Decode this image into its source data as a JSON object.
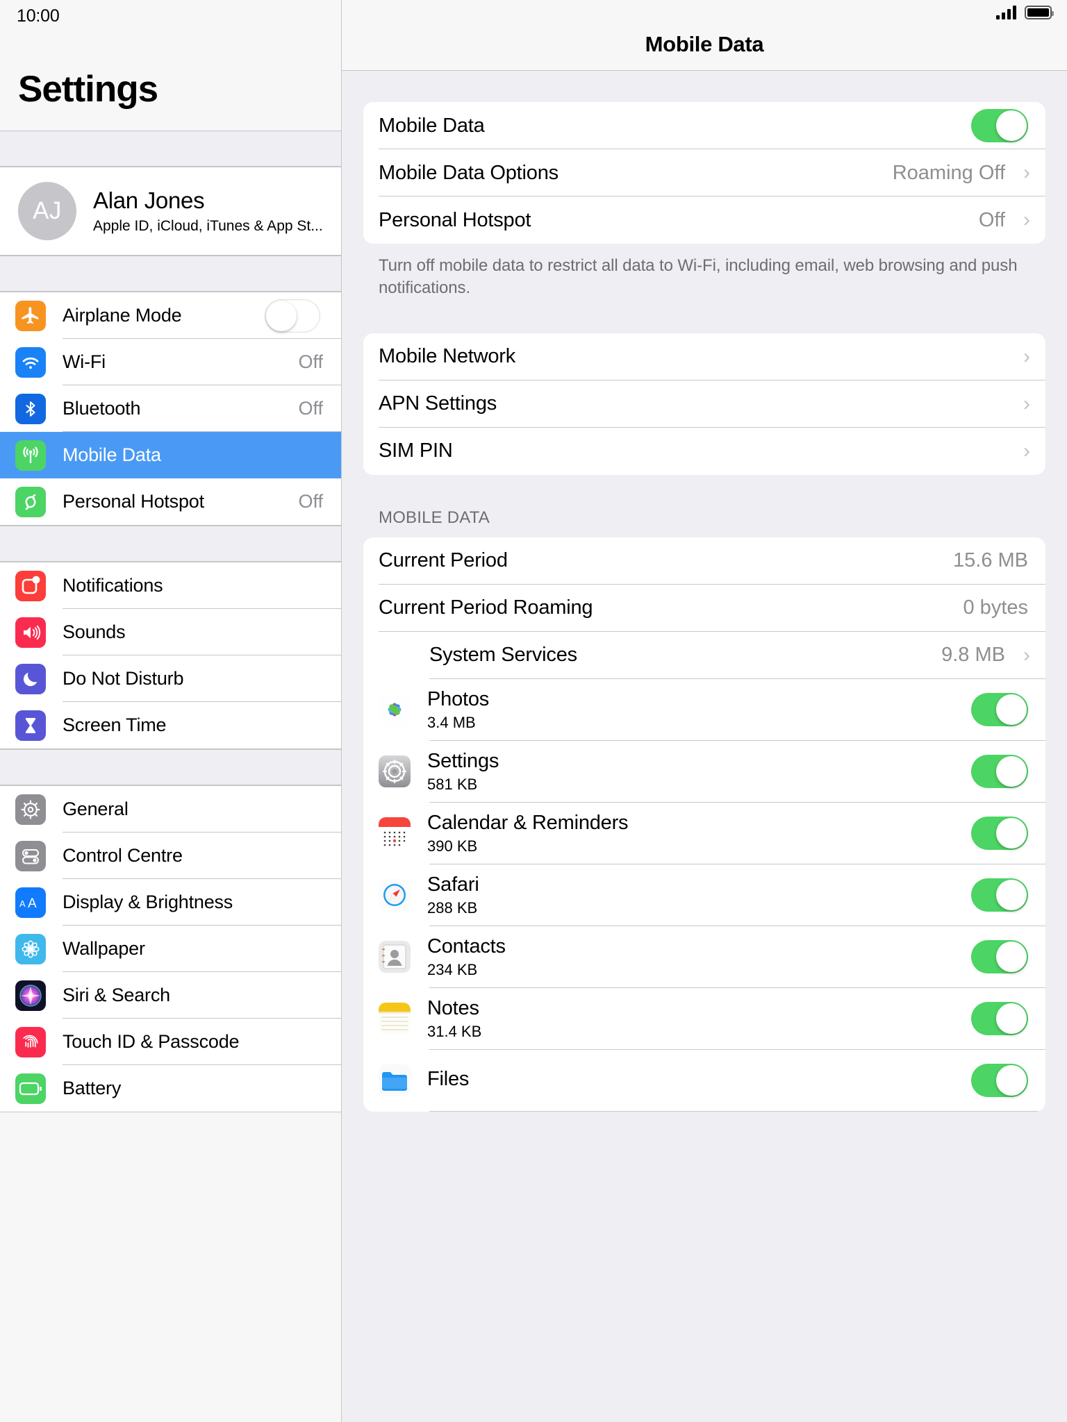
{
  "status_bar": {
    "time": "10:00",
    "signal_bars": 4,
    "battery_full": true
  },
  "sidebar": {
    "title": "Settings",
    "profile": {
      "initials": "AJ",
      "name": "Alan Jones",
      "subtitle": "Apple ID, iCloud, iTunes & App St..."
    },
    "groups": [
      {
        "items": [
          {
            "label": "Airplane Mode",
            "icon": "airplane-icon",
            "color": "#f79421",
            "control": "toggle-off"
          },
          {
            "label": "Wi-Fi",
            "icon": "wifi-icon",
            "color": "#1a82f7",
            "value": "Off"
          },
          {
            "label": "Bluetooth",
            "icon": "bluetooth-icon",
            "color": "#1268e0",
            "value": "Off"
          },
          {
            "label": "Mobile Data",
            "icon": "mobile-data-icon",
            "color": "#4cd464",
            "selected": true
          },
          {
            "label": "Personal Hotspot",
            "icon": "hotspot-icon",
            "color": "#4cd464",
            "value": "Off"
          }
        ]
      },
      {
        "items": [
          {
            "label": "Notifications",
            "icon": "notifications-icon",
            "color": "#fc3d39"
          },
          {
            "label": "Sounds",
            "icon": "sounds-icon",
            "color": "#fb2b4f"
          },
          {
            "label": "Do Not Disturb",
            "icon": "moon-icon",
            "color": "#5856d6"
          },
          {
            "label": "Screen Time",
            "icon": "hourglass-icon",
            "color": "#5856d6"
          }
        ]
      },
      {
        "items": [
          {
            "label": "General",
            "icon": "gear-icon",
            "color": "#8e8e93"
          },
          {
            "label": "Control Centre",
            "icon": "control-centre-icon",
            "color": "#8e8e93"
          },
          {
            "label": "Display & Brightness",
            "icon": "display-brightness-icon",
            "color": "#107bfc"
          },
          {
            "label": "Wallpaper",
            "icon": "wallpaper-icon",
            "color": "#3fb9ec"
          },
          {
            "label": "Siri & Search",
            "icon": "siri-icon",
            "color": "#1a1a2e"
          },
          {
            "label": "Touch ID & Passcode",
            "icon": "fingerprint-icon",
            "color": "#fb2b4f"
          },
          {
            "label": "Battery",
            "icon": "battery-icon",
            "color": "#4cd464"
          }
        ]
      }
    ]
  },
  "detail": {
    "title": "Mobile Data",
    "card_main": [
      {
        "label": "Mobile Data",
        "control": "toggle-on"
      },
      {
        "label": "Mobile Data Options",
        "value": "Roaming Off",
        "chevron": "›"
      },
      {
        "label": "Personal Hotspot",
        "value": "Off",
        "chevron": "›"
      }
    ],
    "footnote": "Turn off mobile data to restrict all data to Wi-Fi, including email, web browsing and push notifications.",
    "card_network": [
      {
        "label": "Mobile Network",
        "chevron": "›"
      },
      {
        "label": "APN Settings",
        "chevron": "›"
      },
      {
        "label": "SIM PIN",
        "chevron": "›"
      }
    ],
    "section_header": "MOBILE DATA",
    "usage_rows": [
      {
        "label": "Current Period",
        "value": "15.6 MB"
      },
      {
        "label": "Current Period Roaming",
        "value": "0 bytes"
      },
      {
        "label": "System Services",
        "value": "9.8 MB",
        "chevron": "›",
        "indent": true
      }
    ],
    "apps": [
      {
        "name": "Photos",
        "size": "3.4 MB",
        "icon": "photos-icon",
        "toggle": "on"
      },
      {
        "name": "Settings",
        "size": "581 KB",
        "icon": "settings-app-icon",
        "toggle": "on"
      },
      {
        "name": "Calendar & Reminders",
        "size": "390 KB",
        "icon": "calendar-icon",
        "toggle": "on"
      },
      {
        "name": "Safari",
        "size": "288 KB",
        "icon": "safari-icon",
        "toggle": "on"
      },
      {
        "name": "Contacts",
        "size": "234 KB",
        "icon": "contacts-icon",
        "toggle": "on"
      },
      {
        "name": "Notes",
        "size": "31.4 KB",
        "icon": "notes-icon",
        "toggle": "on"
      },
      {
        "name": "Files",
        "size": "",
        "icon": "files-icon",
        "toggle": "on"
      }
    ]
  },
  "colors": {
    "accent_blue": "#4a9af5",
    "toggle_green": "#4cd464",
    "panel_bg": "#eeeef3",
    "separator": "#c6c6c8"
  }
}
